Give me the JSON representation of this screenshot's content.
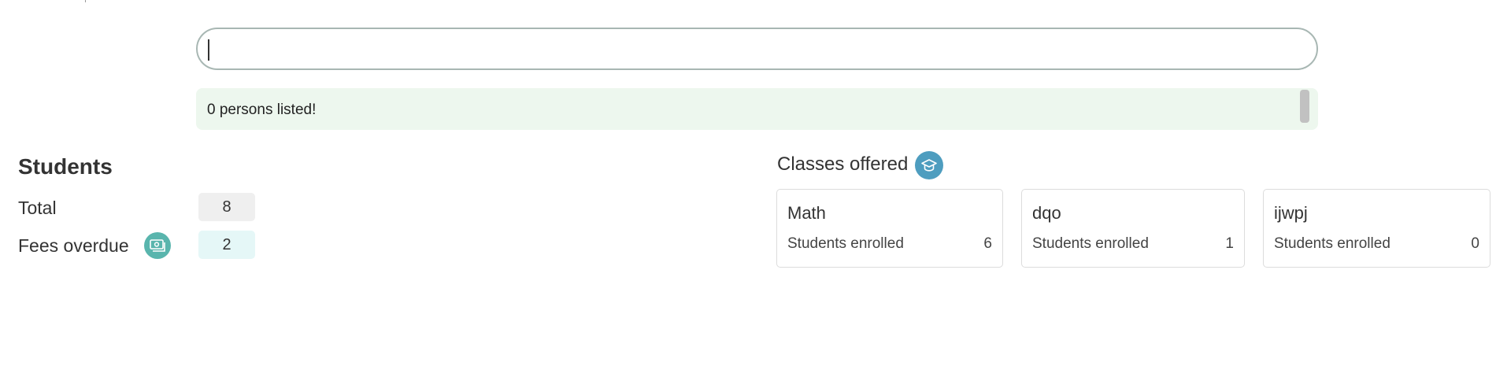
{
  "search": {
    "placeholder": "",
    "value": ""
  },
  "status": {
    "message": "0 persons listed!"
  },
  "students": {
    "title": "Students",
    "total_label": "Total",
    "total_value": "8",
    "fees_label": "Fees overdue",
    "fees_value": "2",
    "fees_icon": "money-icon"
  },
  "classes": {
    "title": "Classes offered",
    "icon": "graduation-cap-icon",
    "enrolled_label": "Students enrolled",
    "items": [
      {
        "name": "Math",
        "enrolled": "6"
      },
      {
        "name": "dqo",
        "enrolled": "1"
      },
      {
        "name": "ijwpj",
        "enrolled": "0"
      }
    ]
  },
  "colors": {
    "status_bg": "#edf7ee",
    "fees_icon_bg": "#59b5ad",
    "classes_icon_bg": "#4e9dbf",
    "fees_badge_bg": "#e5f7f7",
    "total_badge_bg": "#efefef"
  }
}
